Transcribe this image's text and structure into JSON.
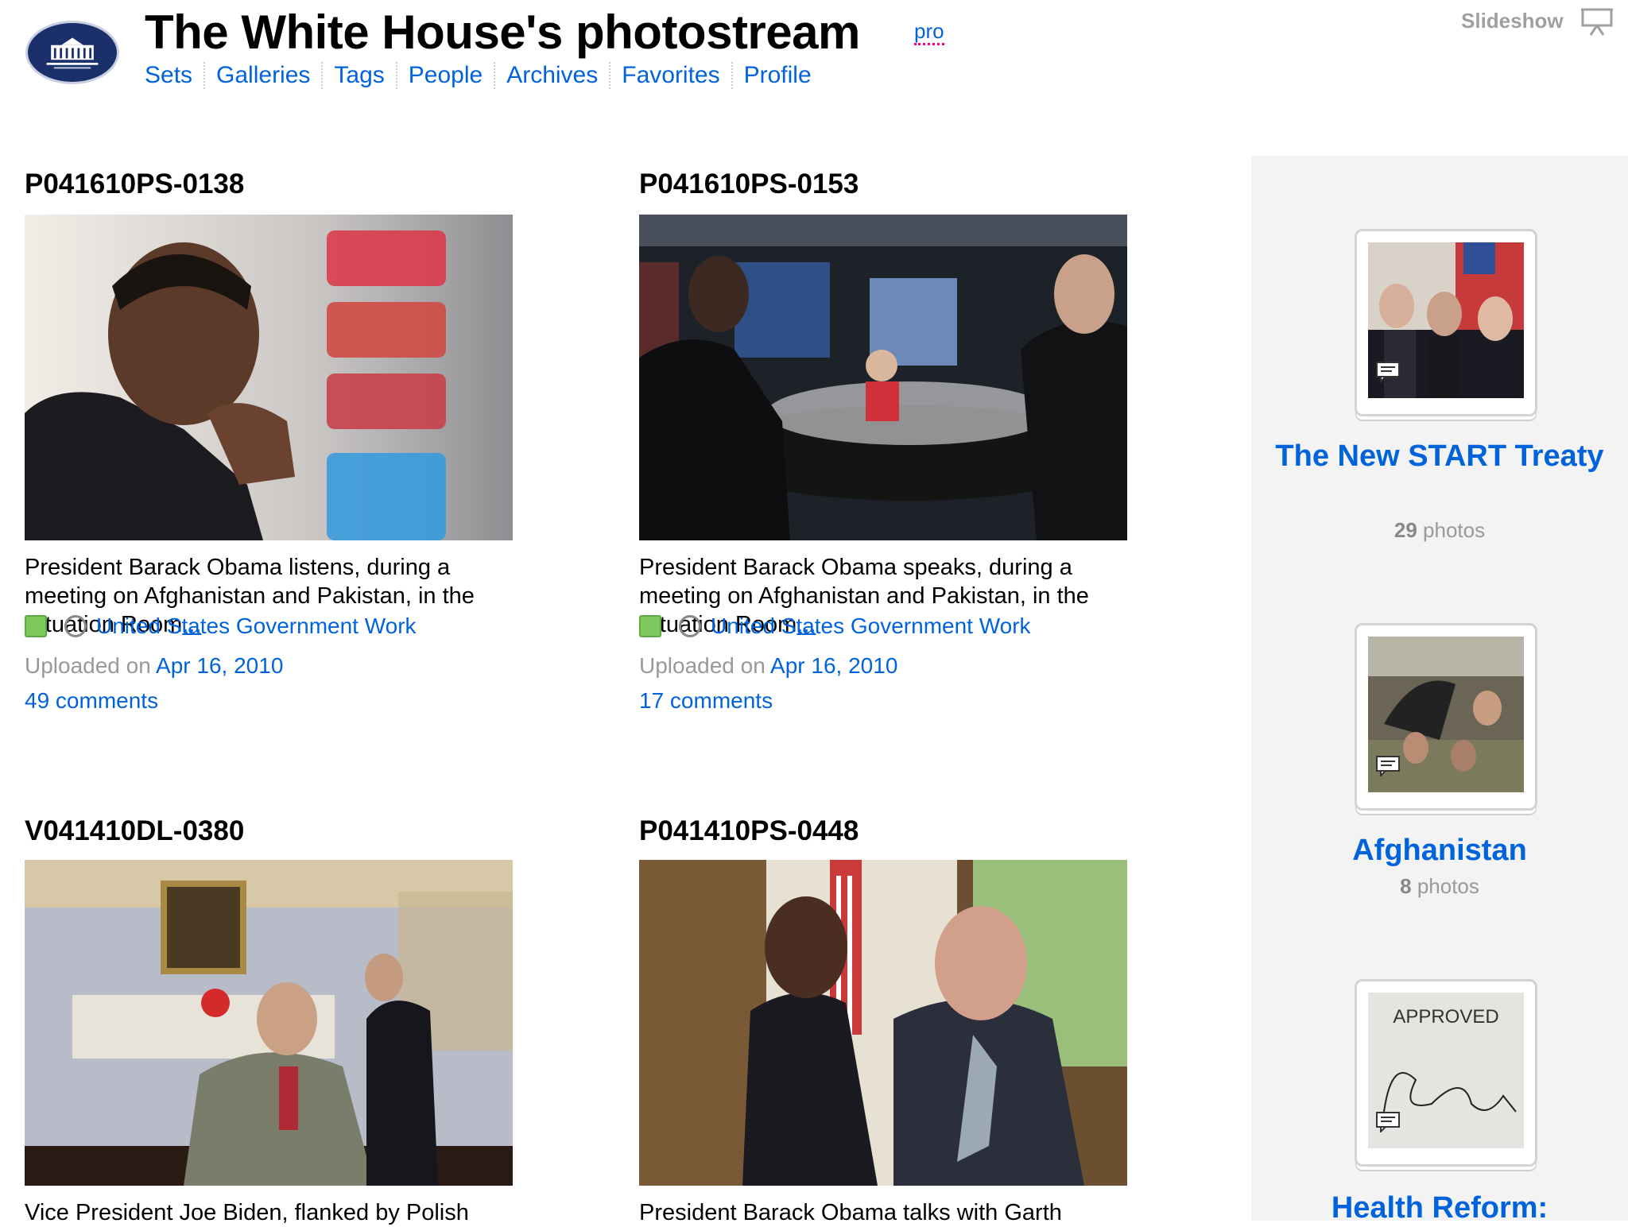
{
  "header": {
    "title": "The White House's photostream",
    "pro_label": "pro",
    "nav": [
      "Sets",
      "Galleries",
      "Tags",
      "People",
      "Archives",
      "Favorites",
      "Profile"
    ],
    "slideshow_label": "Slideshow"
  },
  "photos": [
    {
      "id": "P041610PS-0138",
      "caption": "President Barack Obama listens, during a meeting on Afghanistan and Pakistan, in the Situation Room",
      "more": "...",
      "license": "United States Government Work",
      "uploaded_prefix": "Uploaded on",
      "uploaded_date": "Apr 16, 2010",
      "comments": "49 comments"
    },
    {
      "id": "P041610PS-0153",
      "caption": "President Barack Obama speaks, during a meeting on Afghanistan and Pakistan, in the Situation Room",
      "more": "...",
      "license": "United States Government Work",
      "uploaded_prefix": "Uploaded on",
      "uploaded_date": "Apr 16, 2010",
      "comments": "17 comments"
    },
    {
      "id": "V041410DL-0380",
      "caption": "Vice President Joe Biden, flanked by Polish"
    },
    {
      "id": "P041410PS-0448",
      "caption": "President Barack Obama talks with Garth"
    }
  ],
  "sets": [
    {
      "title": "The New START Treaty",
      "count": "29",
      "count_label": "photos"
    },
    {
      "title": "Afghanistan",
      "count": "8",
      "count_label": "photos"
    },
    {
      "title": "Health Reform:",
      "approved_text": "APPROVED"
    }
  ],
  "colors": {
    "link": "#0063dc",
    "sidebar_bg": "#f3f3f3",
    "license_green": "#7dc95e"
  }
}
